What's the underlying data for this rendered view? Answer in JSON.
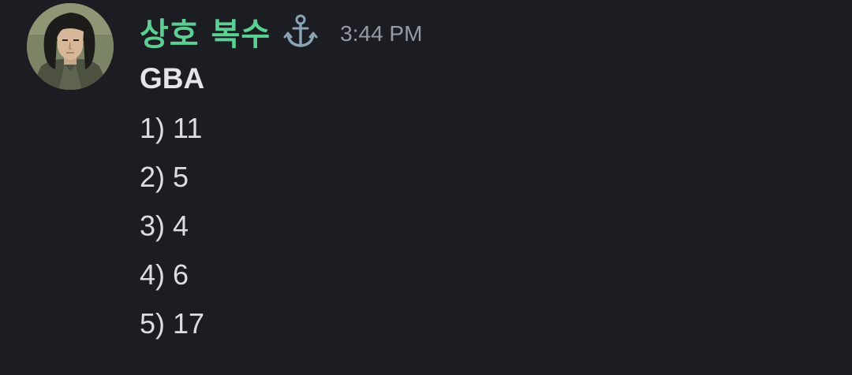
{
  "message": {
    "author": {
      "name": "상호 복수",
      "name_color": "#5ccf93",
      "avatar_icon": "user-avatar-icon",
      "role_icon": "anchor-icon"
    },
    "timestamp": "3:44 PM",
    "title": "GBA",
    "lines": [
      "1) 11",
      "2) 5",
      "3) 4",
      "4) 6",
      "5) 17"
    ]
  },
  "theme": {
    "background": "#1c1d22",
    "text": "#dbdee1",
    "muted": "#949ba4"
  }
}
